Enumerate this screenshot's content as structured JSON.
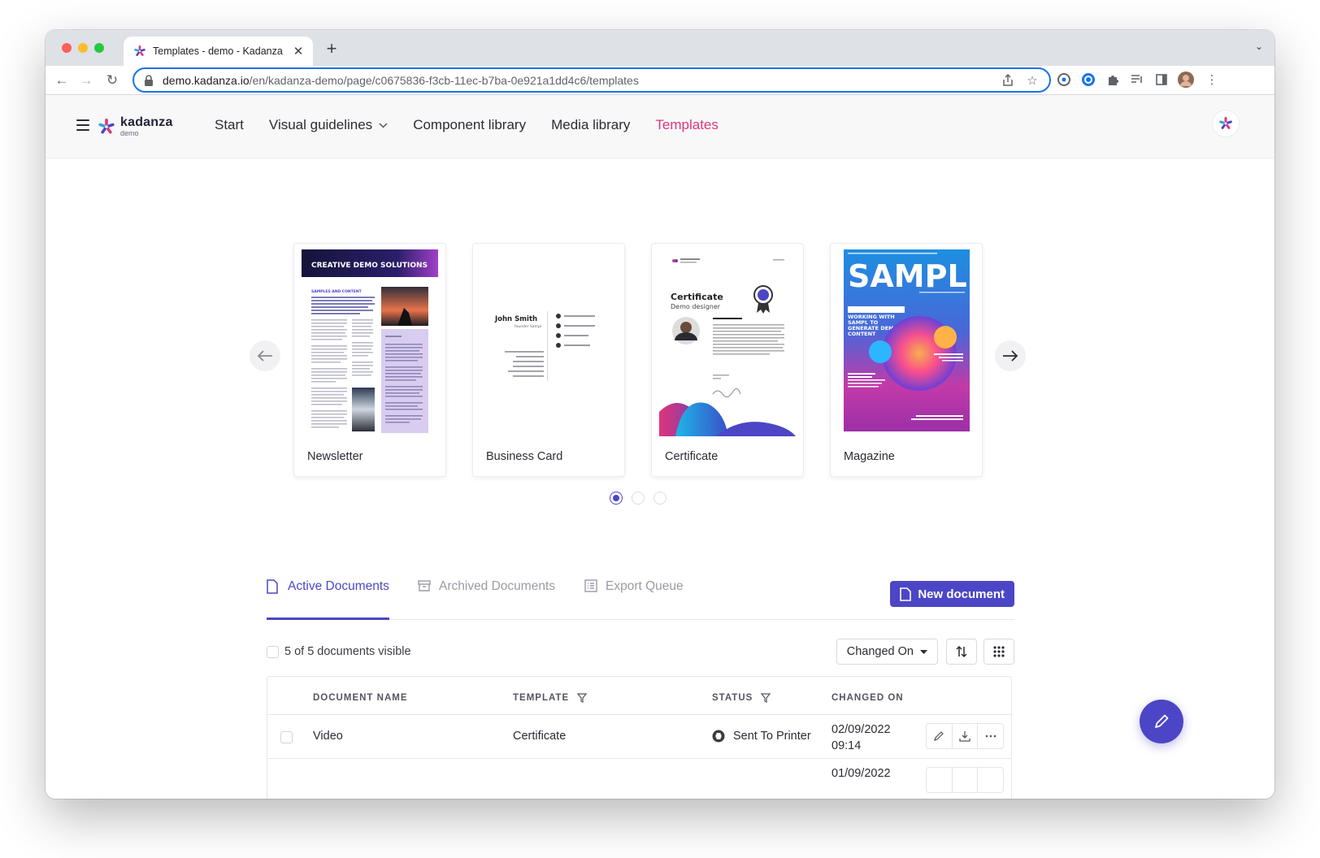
{
  "browser": {
    "tab_title": "Templates - demo - Kadanza",
    "tab_close": "✕",
    "new_tab": "+",
    "url_host": "demo.kadanza.io",
    "url_path": "/en/kadanza-demo/page/c0675836-f3cb-11ec-b7ba-0e921a1dd4c6/templates"
  },
  "site": {
    "logo_name": "kadanza",
    "logo_sub": "demo",
    "nav": [
      {
        "label": "Start"
      },
      {
        "label": "Visual guidelines"
      },
      {
        "label": "Component library"
      },
      {
        "label": "Media library"
      },
      {
        "label": "Templates"
      }
    ]
  },
  "carousel": {
    "cards": [
      {
        "label": "Newsletter",
        "thumb_title": "CREATIVE DEMO SOLUTIONS",
        "thumb_sub": "SAMPLES AND CONTENT"
      },
      {
        "label": "Business Card",
        "thumb_name": "John Smith",
        "thumb_role": "founder Sampl"
      },
      {
        "label": "Certificate",
        "thumb_title": "Certificate",
        "thumb_sub": "Demo designer"
      },
      {
        "label": "Magazine",
        "thumb_title": "SAMPL",
        "thumb_text": "WORKING WITH SAMPL TO GENERATE DEMO CONTENT"
      }
    ],
    "page_count": 3,
    "active_page": 1
  },
  "documents": {
    "tabs": [
      {
        "label": "Active Documents"
      },
      {
        "label": "Archived Documents"
      },
      {
        "label": "Export Queue"
      }
    ],
    "new_button": "New document",
    "visible_text": "5 of 5 documents visible",
    "sort_label": "Changed On",
    "columns": {
      "name": "DOCUMENT NAME",
      "template": "TEMPLATE",
      "status": "STATUS",
      "changed": "CHANGED ON"
    },
    "rows": [
      {
        "name": "Video",
        "template": "Certificate",
        "status": "Sent To Printer",
        "date": "02/09/2022",
        "time": "09:14"
      },
      {
        "date": "01/09/2022"
      }
    ]
  },
  "colors": {
    "accent": "#4c46c6",
    "brand_pink": "#e0347a"
  }
}
